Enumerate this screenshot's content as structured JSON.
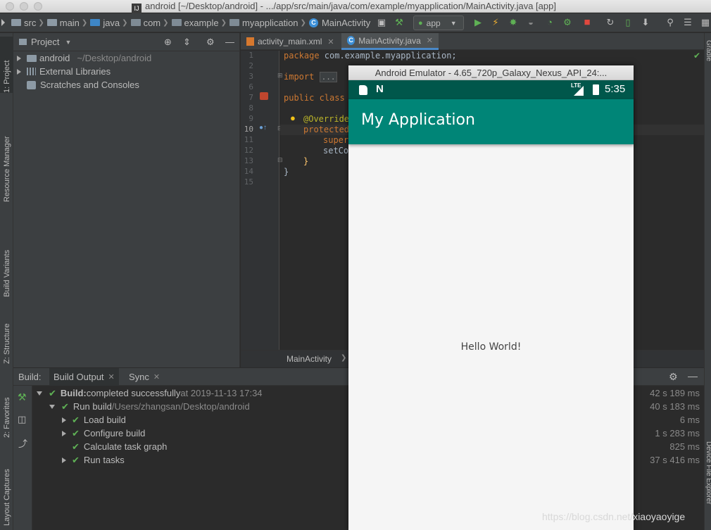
{
  "window": {
    "title": "android [~/Desktop/android] - .../app/src/main/java/com/example/myapplication/MainActivity.java [app]"
  },
  "navbar": {
    "breadcrumbs": [
      "src",
      "main",
      "java",
      "com",
      "example",
      "myapplication",
      "MainActivity"
    ],
    "run_config": "app"
  },
  "left_tabs": {
    "project": "1: Project",
    "resource_manager": "Resource Manager",
    "build_variants": "Build Variants",
    "structure": "Z: Structure",
    "favorites": "2: Favorites",
    "layout_captures": "Layout Captures"
  },
  "right_tabs": {
    "gradle": "Gradle",
    "device_file_explorer": "Device File Explorer"
  },
  "project_panel": {
    "header": "Project",
    "items": [
      {
        "label": "android",
        "path": "~/Desktop/android"
      },
      {
        "label": "External Libraries"
      },
      {
        "label": "Scratches and Consoles"
      }
    ]
  },
  "editor": {
    "tabs": [
      {
        "label": "activity_main.xml"
      },
      {
        "label": "MainActivity.java"
      }
    ],
    "line_numbers": [
      "1",
      "2",
      "3",
      "6",
      "7",
      "8",
      "9",
      "10",
      "11",
      "12",
      "13",
      "14",
      "15"
    ],
    "code": {
      "l1_kw": "package",
      "l1_rest": " com.example.myapplication;",
      "l3_kw": "import",
      "l3_fold": "...",
      "l7_kw": "public class",
      "l9": "@Override",
      "l10": "protected",
      "l11": "super",
      "l12": "setCo",
      "l13": "}",
      "l14": "}"
    },
    "breadcrumb": "MainActivity"
  },
  "build_panel": {
    "label": "Build:",
    "tabs": [
      {
        "label": "Build Output"
      },
      {
        "label": "Sync"
      }
    ],
    "rows": [
      {
        "bold": "Build:",
        "text": " completed successfully",
        "dim": " at 2019-11-13 17:34",
        "duration": "42 s 189 ms"
      },
      {
        "text": "Run build",
        "dim": " /Users/zhangsan/Desktop/android",
        "duration": "40 s 183 ms"
      },
      {
        "text": "Load build",
        "duration": "6 ms"
      },
      {
        "text": "Configure build",
        "duration": "1 s 283 ms"
      },
      {
        "text": "Calculate task graph",
        "duration": "825 ms"
      },
      {
        "text": "Run tasks",
        "duration": "37 s 416 ms"
      }
    ]
  },
  "emulator": {
    "title": "Android Emulator - 4.65_720p_Galaxy_Nexus_API_24:...",
    "status_lte": "LTE",
    "time": "5:35",
    "app_title": "My Application",
    "content_text": "Hello World!"
  },
  "watermark": "https://blog.csdn.net/xiaoyaoyige",
  "colors": {
    "primary": "#008577",
    "primary_dark": "#00574b",
    "ide_bg": "#2b2b2b",
    "success": "#5fb155"
  }
}
